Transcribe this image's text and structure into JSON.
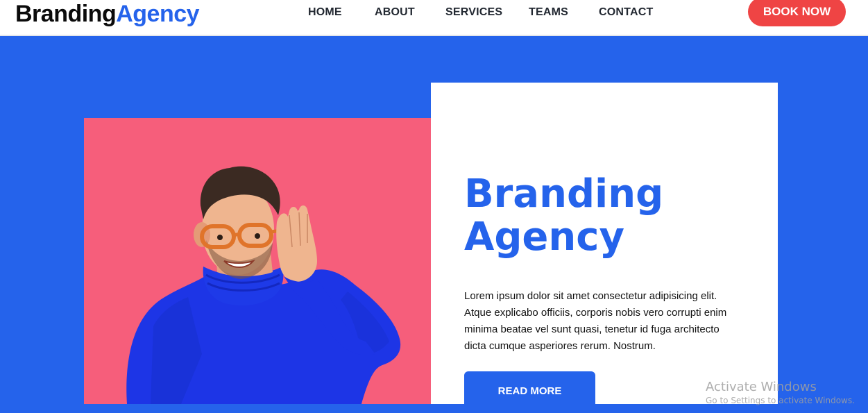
{
  "brand": {
    "part1": "Branding",
    "part2": "Agency"
  },
  "nav": {
    "home": "HOME",
    "about": "ABOUT",
    "services": "SERVICES",
    "teams": "TEAMS",
    "contact": "CONTACT"
  },
  "book_button": "BOOK NOW",
  "hero": {
    "title_line1": "Branding",
    "title_line2": "Agency",
    "body": "Lorem ipsum dolor sit amet consectetur adipisicing elit. Atque explicabo officiis, corporis nobis vero corrupti enim minima beatae vel sunt quasi, tenetur id fuga architecto dicta cumque asperiores rerum. Nostrum.",
    "read_more": "READ MORE"
  },
  "watermark": {
    "line1": "Activate Windows",
    "line2": "Go to Settings to activate Windows."
  },
  "colors": {
    "accent": "#2563eb",
    "cta": "#ef4444",
    "panel": "#f65e7b"
  }
}
